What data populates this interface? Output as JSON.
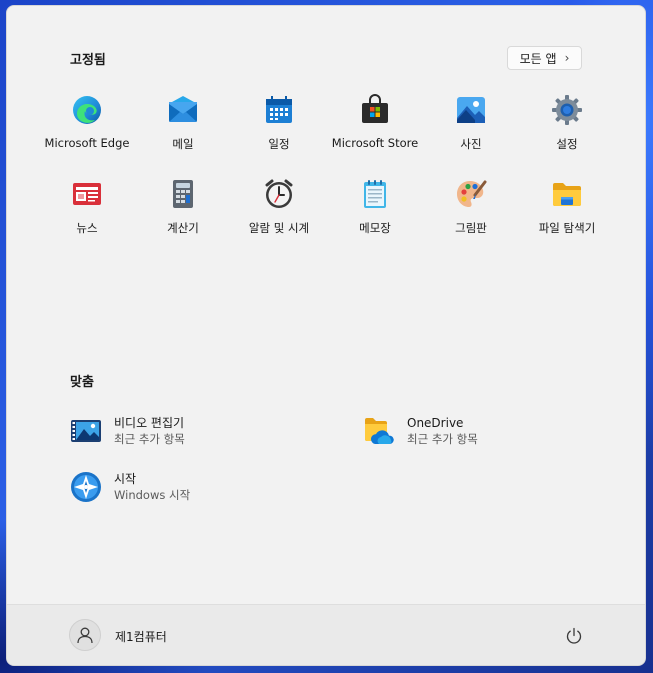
{
  "pinned": {
    "title": "고정됨",
    "all_apps_label": "모든 앱",
    "apps": [
      {
        "label": "Microsoft Edge",
        "icon": "edge-icon"
      },
      {
        "label": "메일",
        "icon": "mail-icon"
      },
      {
        "label": "일정",
        "icon": "calendar-icon"
      },
      {
        "label": "Microsoft Store",
        "icon": "store-icon"
      },
      {
        "label": "사진",
        "icon": "photos-icon"
      },
      {
        "label": "설정",
        "icon": "settings-gear-icon"
      },
      {
        "label": "뉴스",
        "icon": "news-icon"
      },
      {
        "label": "계산기",
        "icon": "calculator-icon"
      },
      {
        "label": "알람 및 시계",
        "icon": "clock-icon"
      },
      {
        "label": "메모장",
        "icon": "notepad-icon"
      },
      {
        "label": "그림판",
        "icon": "paint-icon"
      },
      {
        "label": "파일 탐색기",
        "icon": "folder-icon"
      }
    ]
  },
  "recommended": {
    "title": "맞춤",
    "items": [
      {
        "name": "비디오 편집기",
        "sub": "최근 추가 항목",
        "icon": "video-editor-icon"
      },
      {
        "name": "OneDrive",
        "sub": "최근 추가 항목",
        "icon": "onedrive-icon"
      },
      {
        "name": "시작",
        "sub": "Windows 시작",
        "icon": "get-started-icon"
      }
    ]
  },
  "footer": {
    "user_name": "제1컴퓨터",
    "power_icon": "power-icon"
  }
}
